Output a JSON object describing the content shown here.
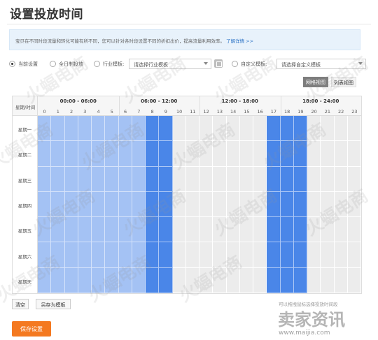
{
  "page": {
    "title": "设置投放时间"
  },
  "notice": {
    "text": "宝贝在不同时段流量和转化可能有所不同，您可以针对各时段设置不同的折扣出价，提高流量利用效率。",
    "link": "了解详情 >>"
  },
  "options": {
    "current": "当前设置",
    "allday": "全日制投放",
    "industry": "行业模板:",
    "industry_placeholder": "请选择行业模板",
    "custom": "自定义模板:",
    "custom_placeholder": "请选择自定义模板"
  },
  "view_tabs": {
    "grid": "网格视图",
    "list": "列表视图"
  },
  "grid": {
    "corner": "星期/时间",
    "blocks": [
      "00:00 - 06:00",
      "06:00 - 12:00",
      "12:00 - 18:00",
      "18:00 - 24:00"
    ],
    "hours": [
      "0",
      "1",
      "2",
      "3",
      "4",
      "5",
      "6",
      "7",
      "8",
      "9",
      "10",
      "11",
      "12",
      "13",
      "14",
      "15",
      "16",
      "17",
      "18",
      "19",
      "20",
      "21",
      "22",
      "23"
    ],
    "days": [
      "星期一",
      "星期二",
      "星期三",
      "星期四",
      "星期五",
      "星期六",
      "星期天"
    ],
    "selected_light_hours": [
      0,
      1,
      2,
      3,
      4,
      5,
      6,
      7
    ],
    "selected_dark_hours": [
      8,
      9,
      17,
      18,
      19
    ],
    "colors": {
      "light": "#a4c2f4",
      "dark": "#4a86e8",
      "empty": "#ececec"
    }
  },
  "actions": {
    "clear": "清空",
    "save_template": "另存为模板",
    "hint": "可以拖拽鼠标选择投放时间段",
    "save": "保存设置"
  },
  "watermark": {
    "text": "火蝠电商",
    "brand": "卖家资讯",
    "brand_url": "www.maijia.com"
  }
}
